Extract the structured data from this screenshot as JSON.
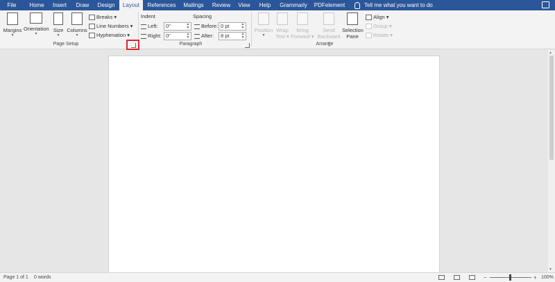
{
  "tabs": [
    "File",
    "Home",
    "Insert",
    "Draw",
    "Design",
    "Layout",
    "References",
    "Mailings",
    "Review",
    "View",
    "Help",
    "Grammarly",
    "PDFelement"
  ],
  "active_tab": "Layout",
  "tell_me": "Tell me what you want to do",
  "page_setup": {
    "margins": "Margins",
    "orientation": "Orientation",
    "size": "Size",
    "columns": "Columns",
    "breaks": "Breaks",
    "line_numbers": "Line Numbers",
    "hyphenation": "Hyphenation",
    "group_label": "Page Setup"
  },
  "paragraph": {
    "indent_label": "Indent",
    "spacing_label": "Spacing",
    "left_label": "Left:",
    "right_label": "Right:",
    "before_label": "Before:",
    "after_label": "After:",
    "left_value": "0\"",
    "right_value": "0\"",
    "before_value": "0 pt",
    "after_value": "8 pt",
    "group_label": "Paragraph"
  },
  "arrange": {
    "position": "Position",
    "wrap_text_1": "Wrap",
    "wrap_text_2": "Text",
    "bring_forward_1": "Bring",
    "bring_forward_2": "Forward",
    "send_backward_1": "Send",
    "send_backward_2": "Backward",
    "selection_pane_1": "Selection",
    "selection_pane_2": "Pane",
    "align": "Align",
    "group": "Group",
    "rotate": "Rotate",
    "group_label": "Arrange"
  },
  "status": {
    "page": "Page 1 of 1",
    "words": "0 words",
    "zoom": "100%",
    "zoom_minus": "−",
    "zoom_plus": "+"
  },
  "colors": {
    "accent": "#2b579a",
    "highlight": "#d9262e"
  }
}
